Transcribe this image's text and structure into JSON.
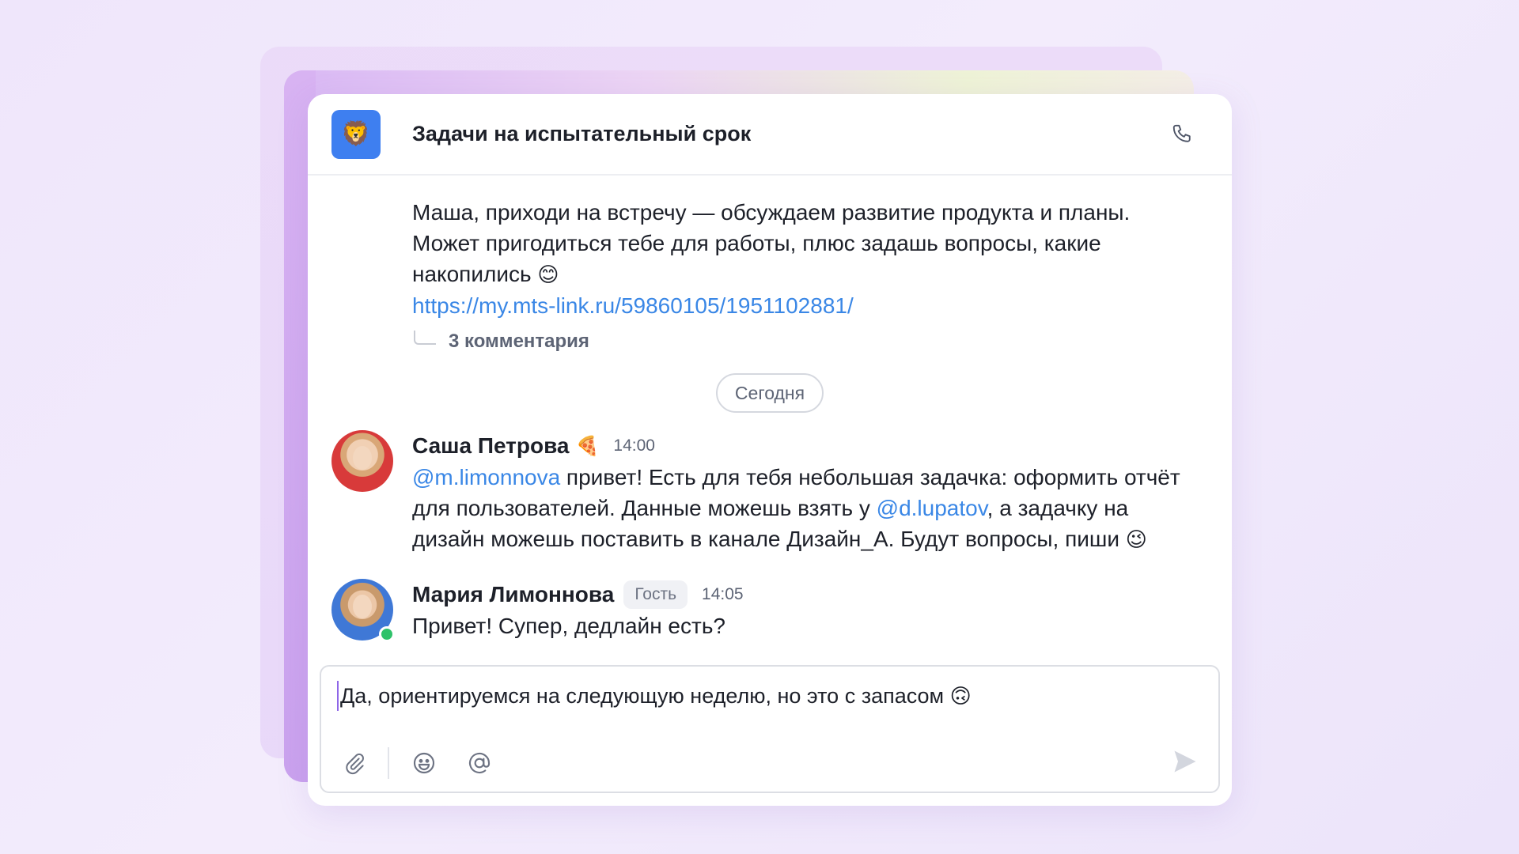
{
  "header": {
    "chat_avatar_emoji": "🦁",
    "chat_title": "Задачи на испытательный срок",
    "call_icon": "phone-icon"
  },
  "first_message": {
    "line1": "Маша, приходи на встречу — обсуждаем развитие продукта и планы.",
    "line2": "Может пригодиться тебе для работы, плюс задашь вопросы, какие",
    "line3": "накопились",
    "emoji": "😊",
    "link": "https://my.mts-link.ru/59860105/1951102881/",
    "comments": "3 комментария"
  },
  "date_separator": "Сегодня",
  "messages": [
    {
      "author": "Саша Петрова",
      "author_emoji": "🍕",
      "time": "14:00",
      "mention1": "@m.limonnova",
      "text1": " привет! Есть для тебя небольшая задачка: оформить отчёт",
      "text2": "для пользователей. Данные можешь взять у ",
      "mention2": "@d.lupatov",
      "text3": ", а задачку на",
      "text4": "дизайн можешь поставить в канале Дизайн_А. Будут вопросы, пиши",
      "emoji": "😉"
    },
    {
      "author": "Мария Лимоннова",
      "badge": "Гость",
      "time": "14:05",
      "text": "Привет! Супер, дедлайн есть?",
      "online": true
    }
  ],
  "composer": {
    "text": "Да, ориентируемся на следующую неделю, но это с запасом",
    "emoji": "🙃",
    "tools": [
      "paperclip-icon",
      "emoji-icon",
      "mention-icon"
    ],
    "send_icon": "send-icon"
  },
  "colors": {
    "accent_blue": "#3e7ff0",
    "link": "#3a87e6",
    "online": "#2fc26a",
    "text": "#1d2029"
  }
}
